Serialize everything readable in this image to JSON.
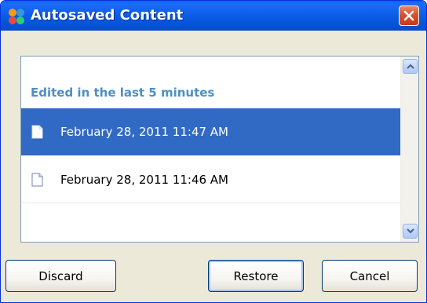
{
  "window": {
    "title": "Autosaved Content",
    "icon": "app-colorful-icon",
    "close_icon": "close-icon"
  },
  "list": {
    "group_header": "Edited in the last 5 minutes",
    "items": [
      {
        "label": "February 28, 2011 11:47 AM",
        "icon": "document-icon",
        "selected": true
      },
      {
        "label": "February 28, 2011 11:46 AM",
        "icon": "document-icon",
        "selected": false
      }
    ],
    "scroll_up_icon": "chevron-up-icon",
    "scroll_down_icon": "chevron-down-icon"
  },
  "buttons": {
    "discard": "Discard",
    "restore": "Restore",
    "cancel": "Cancel"
  },
  "colors": {
    "titlebar": "#0553d6",
    "selection": "#316ac5",
    "group_header": "#4d8fc7",
    "dialog_bg": "#ece9d8",
    "close_button": "#d9512e"
  }
}
